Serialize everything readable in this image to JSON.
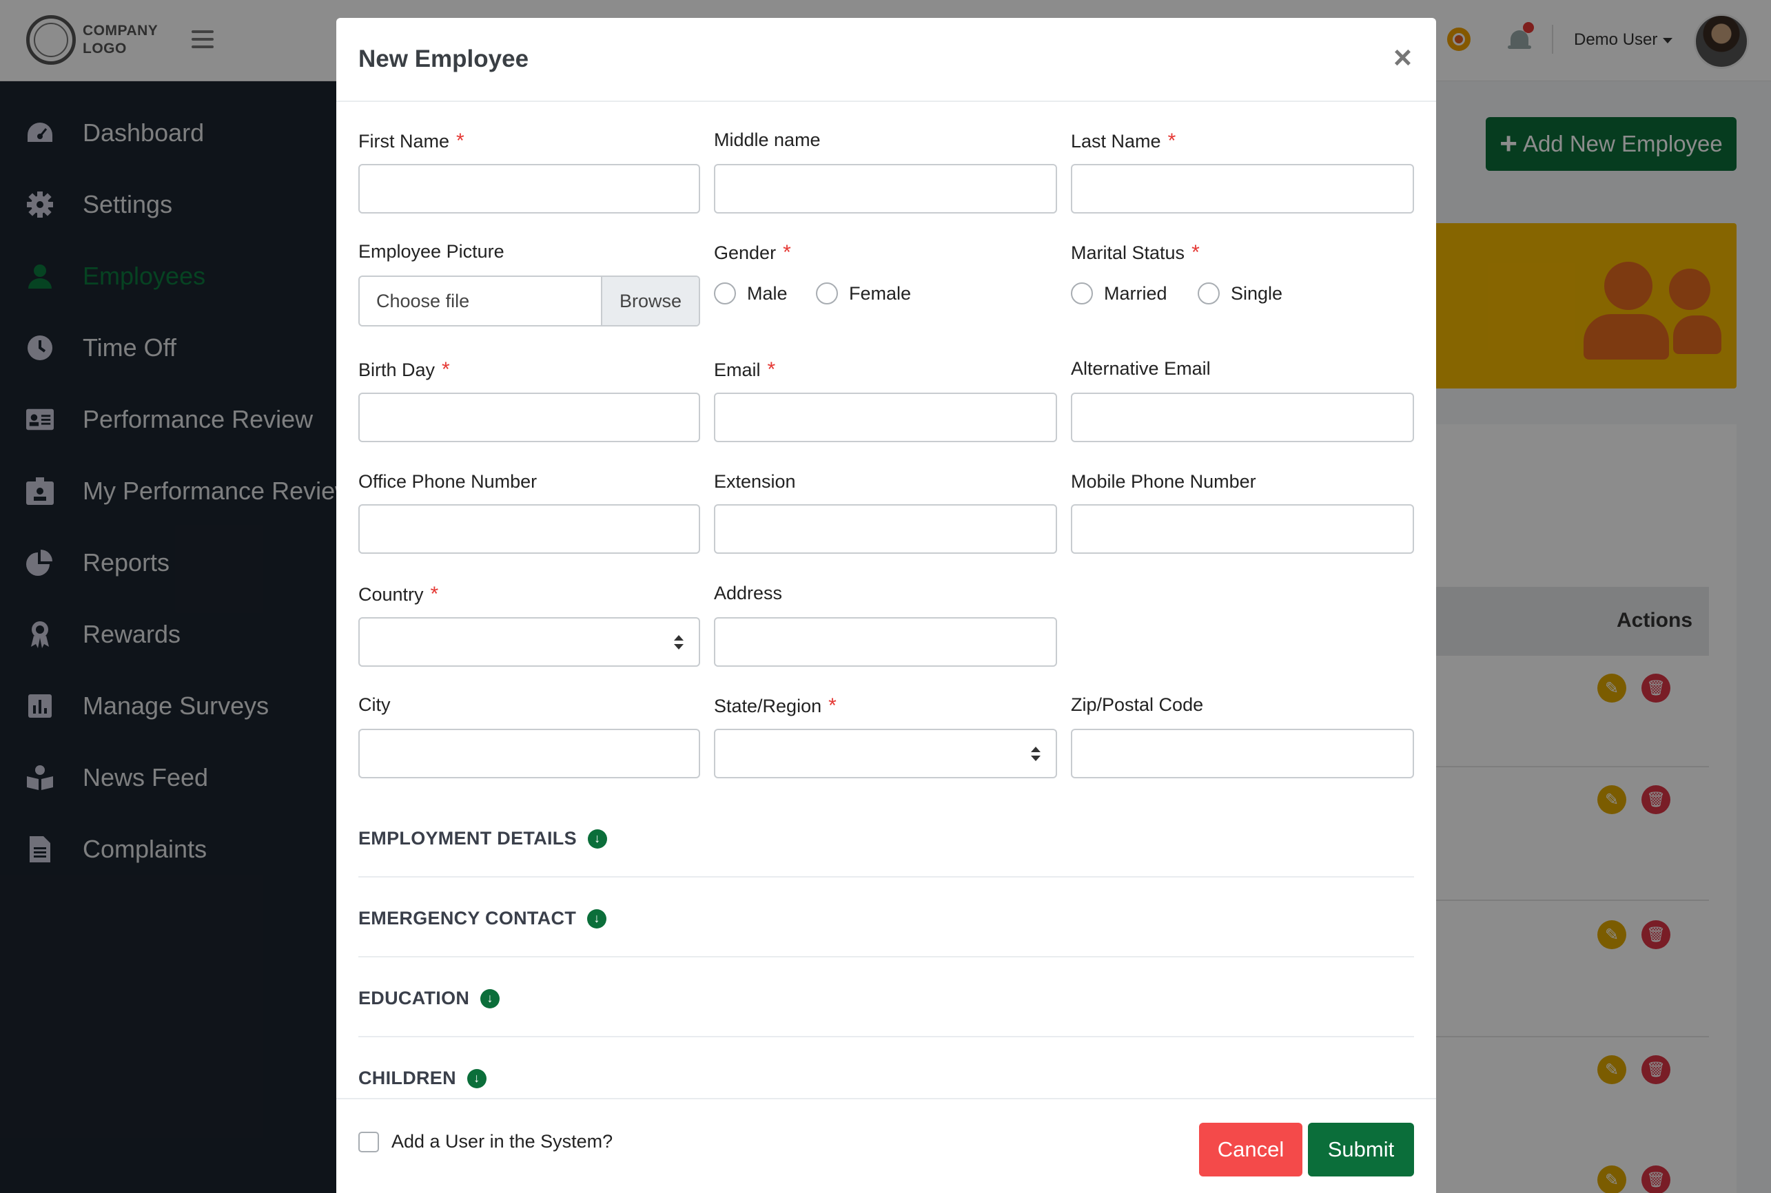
{
  "topbar": {
    "logo_text": "COMPANY\nLOGO",
    "user_name": "Demo User"
  },
  "sidebar": {
    "items": [
      {
        "label": "Dashboard",
        "icon": "tachometer-icon"
      },
      {
        "label": "Settings",
        "icon": "gear-icon"
      },
      {
        "label": "Employees",
        "icon": "user-icon",
        "active": true
      },
      {
        "label": "Time Off",
        "icon": "clock-icon"
      },
      {
        "label": "Performance Review",
        "icon": "id-card-icon"
      },
      {
        "label": "My Performance Review",
        "icon": "id-badge-icon"
      },
      {
        "label": "Reports",
        "icon": "pie-chart-icon"
      },
      {
        "label": "Rewards",
        "icon": "award-icon"
      },
      {
        "label": "Manage Surveys",
        "icon": "bar-chart-icon"
      },
      {
        "label": "News Feed",
        "icon": "book-reader-icon"
      },
      {
        "label": "Complaints",
        "icon": "file-icon"
      }
    ]
  },
  "page": {
    "add_button": "Add New Employee",
    "table_actions_header": "Actions"
  },
  "modal": {
    "title": "New Employee",
    "close": "×",
    "fields": {
      "first_name": "First Name",
      "middle_name": "Middle name",
      "last_name": "Last Name",
      "employee_picture": "Employee Picture",
      "file_placeholder": "Choose file",
      "browse": "Browse",
      "gender": "Gender",
      "gender_male": "Male",
      "gender_female": "Female",
      "marital_status": "Marital Status",
      "marital_married": "Married",
      "marital_single": "Single",
      "birth_day": "Birth Day",
      "email": "Email",
      "alt_email": "Alternative Email",
      "office_phone": "Office Phone Number",
      "extension": "Extension",
      "mobile_phone": "Mobile Phone Number",
      "country": "Country",
      "address": "Address",
      "city": "City",
      "state": "State/Region",
      "zip": "Zip/Postal Code"
    },
    "required_mark": "*",
    "sections": [
      "EMPLOYMENT DETAILS",
      "EMERGENCY CONTACT",
      "EDUCATION",
      "CHILDREN"
    ],
    "footer": {
      "add_user_checkbox": "Add a User in the System?",
      "cancel": "Cancel",
      "submit": "Submit"
    }
  },
  "colors": {
    "primary_green": "#0b6e3a",
    "danger_red": "#f44a4a",
    "required_red": "#e53935",
    "sidebar_bg": "#1d2530",
    "card_yellow": "#f5b800"
  }
}
